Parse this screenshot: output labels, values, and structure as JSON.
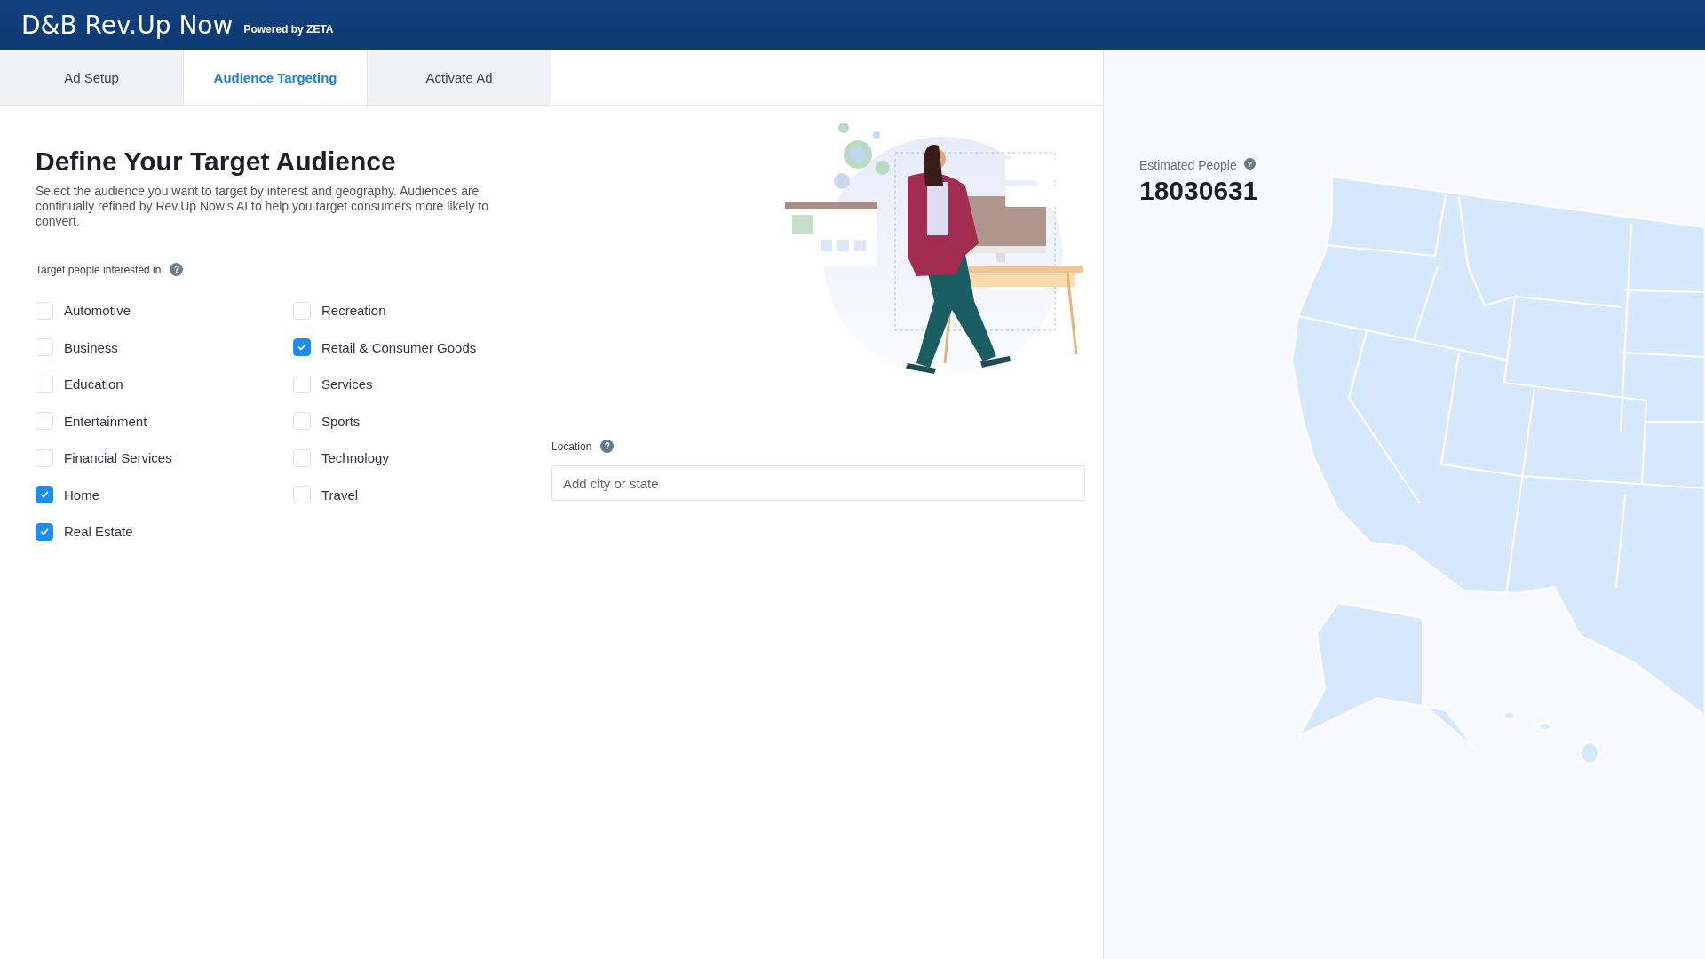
{
  "header": {
    "logo": "D&B Rev.Up Now",
    "powered_by": "Powered by ZETA"
  },
  "tabs": [
    {
      "label": "Ad Setup",
      "selected": false
    },
    {
      "label": "Audience Targeting",
      "selected": true
    },
    {
      "label": "Activate Ad",
      "selected": false
    }
  ],
  "title": "Define Your Target Audience",
  "description": "Select the audience you want to target by interest and geography. Audiences are continually refined by Rev.Up Now’s AI to help you target consumers more likely to convert.",
  "interests_label": "Target people interested in",
  "interests_help": "?",
  "interests": [
    {
      "label": "Automotive",
      "checked": false
    },
    {
      "label": "Business",
      "checked": false
    },
    {
      "label": "Education",
      "checked": false
    },
    {
      "label": "Entertainment",
      "checked": false
    },
    {
      "label": "Financial Services",
      "checked": false
    },
    {
      "label": "Home",
      "checked": true
    },
    {
      "label": "Real Estate",
      "checked": true
    },
    {
      "label": "Recreation",
      "checked": false
    },
    {
      "label": "Retail & Consumer Goods",
      "checked": true
    },
    {
      "label": "Services",
      "checked": false
    },
    {
      "label": "Sports",
      "checked": false
    },
    {
      "label": "Technology",
      "checked": false
    },
    {
      "label": "Travel",
      "checked": false
    }
  ],
  "location": {
    "label": "Location",
    "help": "?",
    "placeholder": "Add city or state"
  },
  "estimate": {
    "label": "Estimated People",
    "help": "?",
    "value": "18030631"
  }
}
